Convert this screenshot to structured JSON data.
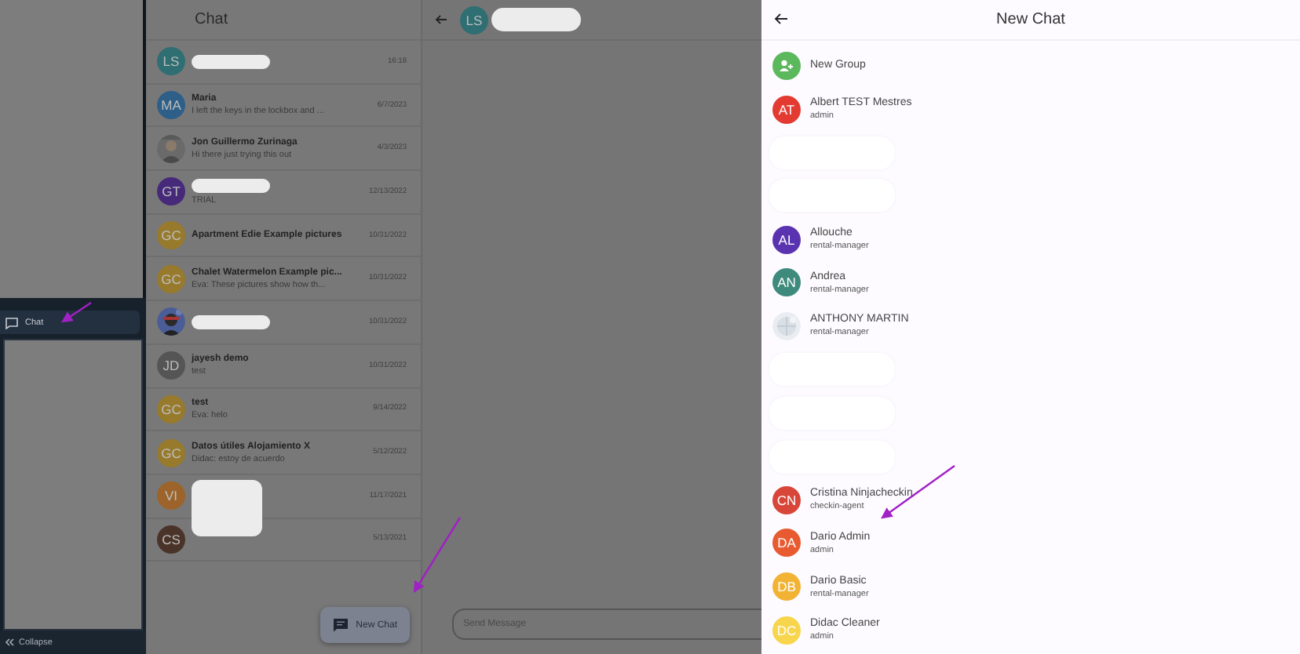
{
  "sidebar": {
    "items": [
      {
        "label": "Chat",
        "selected": true
      }
    ],
    "collapse": "Collapse"
  },
  "chat_list": {
    "title": "Chat",
    "rows": [
      {
        "avatar": {
          "initials": "LS",
          "color": "#2f6e72"
        },
        "name_redacted": true,
        "date": "16:18"
      },
      {
        "avatar": {
          "initials": "MA",
          "color": "#2d5f88"
        },
        "name": "Maria",
        "preview": "I left the keys in the lockbox and ...",
        "date": "6/7/2023"
      },
      {
        "name": "Jon Guillermo Zurinaga",
        "preview": "Hi there just trying this out",
        "date": "4/3/2023"
      },
      {
        "avatar": {
          "initials": "GT",
          "color": "#47297a"
        },
        "name_redacted": true,
        "preview": "TRIAL",
        "date": "12/13/2022"
      },
      {
        "avatar": {
          "initials": "GC",
          "color": "#977a2c"
        },
        "name": "Apartment Edie Example pictures",
        "date": "10/31/2022"
      },
      {
        "avatar": {
          "initials": "GC",
          "color": "#977a2c"
        },
        "name": "Chalet Watermelon Example pic...",
        "preview": "Eva: These pictures show how th...",
        "date": "10/31/2022"
      },
      {
        "name_redacted": true,
        "date": "10/31/2022"
      },
      {
        "avatar": {
          "initials": "JD",
          "color": "#555555"
        },
        "name": "jayesh demo",
        "preview": "test",
        "date": "10/31/2022"
      },
      {
        "avatar": {
          "initials": "GC",
          "color": "#977a2c"
        },
        "name": "test",
        "preview": "Eva: helo",
        "date": "9/14/2022"
      },
      {
        "avatar": {
          "initials": "GC",
          "color": "#977a2c"
        },
        "name": "Datos útiles Alojamiento X",
        "preview": "Didac: estoy de acuerdo",
        "date": "5/12/2022"
      },
      {
        "avatar": {
          "initials": "VI",
          "color": "#9c642a"
        },
        "name_redacted": true,
        "redaction_large": true,
        "date": "11/17/2021"
      },
      {
        "avatar": {
          "initials": "CS",
          "color": "#4a3328"
        },
        "date": "5/13/2021"
      }
    ],
    "new_chat_button": "New Chat"
  },
  "conversation": {
    "avatar": {
      "initials": "LS",
      "color": "#2f6e72"
    },
    "name_redacted": true,
    "message_field": {
      "placeholder": "Send Message"
    }
  },
  "new_chat_panel": {
    "title": "New Chat",
    "items": [
      {
        "kind": "group",
        "label": "New Group",
        "color": "#5cb85c"
      },
      {
        "kind": "contact",
        "initials": "AT",
        "color": "#e33b32",
        "name": "Albert TEST Mestres",
        "role": "admin"
      },
      {
        "kind": "redacted"
      },
      {
        "kind": "redacted"
      },
      {
        "kind": "contact",
        "initials": "AL",
        "color": "#5a34b0",
        "name": "Allouche",
        "role": "rental-manager"
      },
      {
        "kind": "contact",
        "initials": "AN",
        "color": "#3e8a7c",
        "name": "Andrea",
        "role": "rental-manager"
      },
      {
        "kind": "contact_picture",
        "name": "ANTHONY MARTIN",
        "role": "rental-manager"
      },
      {
        "kind": "redacted"
      },
      {
        "kind": "redacted"
      },
      {
        "kind": "redacted"
      },
      {
        "kind": "contact",
        "initials": "CN",
        "color": "#d8463a",
        "name": "Cristina Ninjacheckin",
        "role": "checkin-agent"
      },
      {
        "kind": "contact",
        "initials": "DA",
        "color": "#e85a30",
        "name": "Dario Admin",
        "role": "admin"
      },
      {
        "kind": "contact",
        "initials": "DB",
        "color": "#f2b233",
        "name": "Dario Basic",
        "role": "rental-manager"
      },
      {
        "kind": "contact",
        "initials": "DC",
        "color": "#f7d54c",
        "name": "Didac Cleaner",
        "role": "admin"
      }
    ]
  }
}
